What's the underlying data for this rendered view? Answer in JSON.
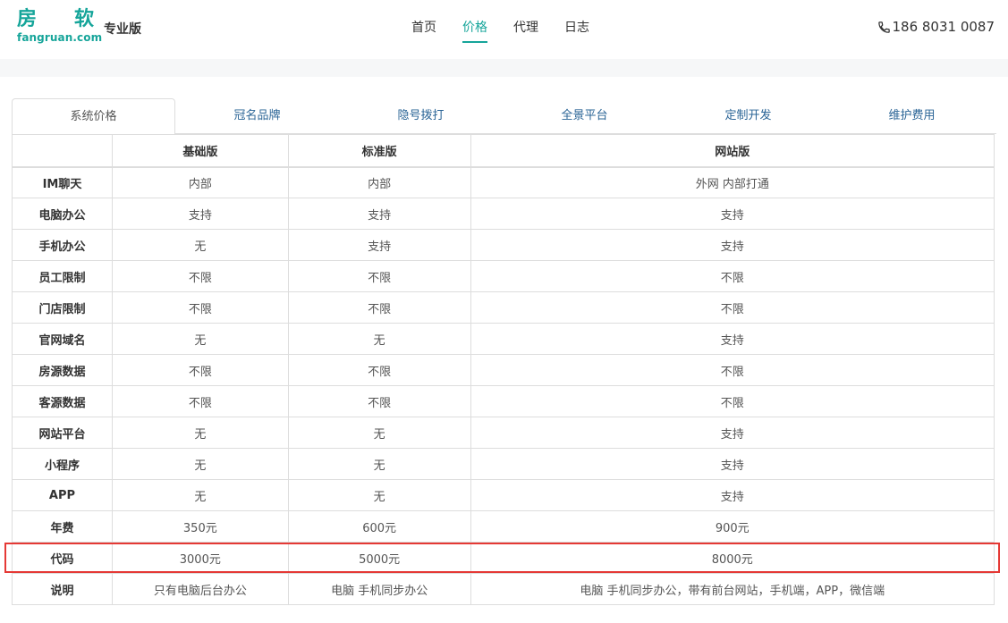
{
  "brand": {
    "char1": "房",
    "char2": "软",
    "domain": "fangruan.com",
    "edition": "专业版",
    "color": "#16a59a"
  },
  "nav": [
    {
      "label": "首页",
      "active": false
    },
    {
      "label": "价格",
      "active": true
    },
    {
      "label": "代理",
      "active": false
    },
    {
      "label": "日志",
      "active": false
    }
  ],
  "phone": {
    "icon": "phone-icon",
    "number": "186 8031 0087"
  },
  "tabs": [
    "系统价格",
    "冠名品牌",
    "隐号拨打",
    "全景平台",
    "定制开发",
    "维护费用"
  ],
  "table": {
    "headers": [
      "",
      "基础版",
      "标准版",
      "网站版"
    ],
    "rows": [
      [
        "IM聊天",
        "内部",
        "内部",
        "外网 内部打通"
      ],
      [
        "电脑办公",
        "支持",
        "支持",
        "支持"
      ],
      [
        "手机办公",
        "无",
        "支持",
        "支持"
      ],
      [
        "员工限制",
        "不限",
        "不限",
        "不限"
      ],
      [
        "门店限制",
        "不限",
        "不限",
        "不限"
      ],
      [
        "官网域名",
        "无",
        "无",
        "支持"
      ],
      [
        "房源数据",
        "不限",
        "不限",
        "不限"
      ],
      [
        "客源数据",
        "不限",
        "不限",
        "不限"
      ],
      [
        "网站平台",
        "无",
        "无",
        "支持"
      ],
      [
        "小程序",
        "无",
        "无",
        "支持"
      ],
      [
        "APP",
        "无",
        "无",
        "支持"
      ],
      [
        "年费",
        "350元",
        "600元",
        "900元"
      ],
      [
        "代码",
        "3000元",
        "5000元",
        "8000元"
      ],
      [
        "说明",
        "只有电脑后台办公",
        "电脑 手机同步办公",
        "电脑 手机同步办公，带有前台网站，手机端，APP，微信端"
      ]
    ]
  },
  "highlight_color": "#e53935"
}
